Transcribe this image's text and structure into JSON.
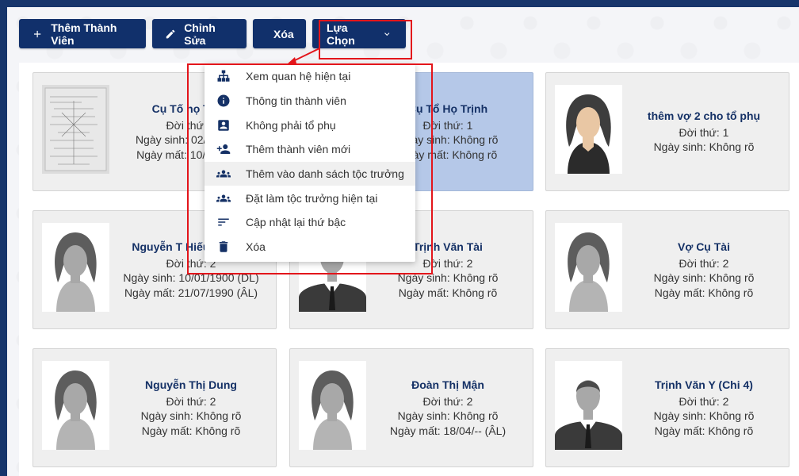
{
  "toolbar": {
    "add_label": "Thêm Thành Viên",
    "edit_label": "Chỉnh Sửa",
    "delete_label": "Xóa",
    "choice_label": "Lựa Chọn"
  },
  "menu": {
    "items": [
      {
        "label": "Xem quan hệ hiện tại",
        "icon": "sitemap-icon"
      },
      {
        "label": "Thông tin thành viên",
        "icon": "info-icon"
      },
      {
        "label": "Không phải tổ phụ",
        "icon": "contact-card-icon"
      },
      {
        "label": "Thêm thành viên mới",
        "icon": "person-add-icon"
      },
      {
        "label": "Thêm vào danh sách tộc trưởng",
        "icon": "group-icon"
      },
      {
        "label": "Đặt làm tộc trưởng hiện tại",
        "icon": "group-icon"
      },
      {
        "label": "Cập nhật lại thứ bậc",
        "icon": "sort-icon"
      },
      {
        "label": "Xóa",
        "icon": "trash-icon"
      }
    ]
  },
  "members": [
    {
      "name": "Cụ Tố họ Trịnh",
      "generation": "Đời thứ: 1",
      "birth": "Ngày sinh: 02/09/1900",
      "death": "Ngày mất: 10/03/1990",
      "photo": "document-photo"
    },
    {
      "name": "Cụ Tổ Họ Trịnh",
      "generation": "Đời thứ: 1",
      "birth": "Ngày sinh: Không rõ",
      "death": "Ngày mất: Không rõ",
      "photo": "none"
    },
    {
      "name": "thêm vợ 2 cho tổ phụ",
      "generation": "Đời thứ: 1",
      "birth": "Ngày sinh: Không rõ",
      "death": "",
      "photo": "female-color"
    },
    {
      "name": "Nguyễn T Hiếu Dương",
      "generation": "Đời thứ: 2",
      "birth": "Ngày sinh: 10/01/1900 (DL)",
      "death": "Ngày mất: 21/07/1990 (ÂL)",
      "photo": "female"
    },
    {
      "name": "Trịnh Văn Tài",
      "generation": "Đời thứ: 2",
      "birth": "Ngày sinh: Không rõ",
      "death": "Ngày mất: Không rõ",
      "photo": "male"
    },
    {
      "name": "Vợ Cụ Tài",
      "generation": "Đời thứ: 2",
      "birth": "Ngày sinh: Không rõ",
      "death": "Ngày mất: Không rõ",
      "photo": "female"
    },
    {
      "name": "Nguyễn Thị Dung",
      "generation": "Đời thứ: 2",
      "birth": "Ngày sinh: Không rõ",
      "death": "Ngày mất: Không rõ",
      "photo": "female"
    },
    {
      "name": "Đoàn Thị Mận",
      "generation": "Đời thứ: 2",
      "birth": "Ngày sinh: Không rõ",
      "death": "Ngày mất: 18/04/-- (ÂL)",
      "photo": "female"
    },
    {
      "name": "Trịnh Văn Y (Chi 4)",
      "generation": "Đời thứ: 2",
      "birth": "Ngày sinh: Không rõ",
      "death": "Ngày mất: Không rõ",
      "photo": "male"
    }
  ],
  "colors": {
    "primary": "#11306b",
    "highlight": "#e3151b",
    "selected": "#b5c8e8"
  }
}
